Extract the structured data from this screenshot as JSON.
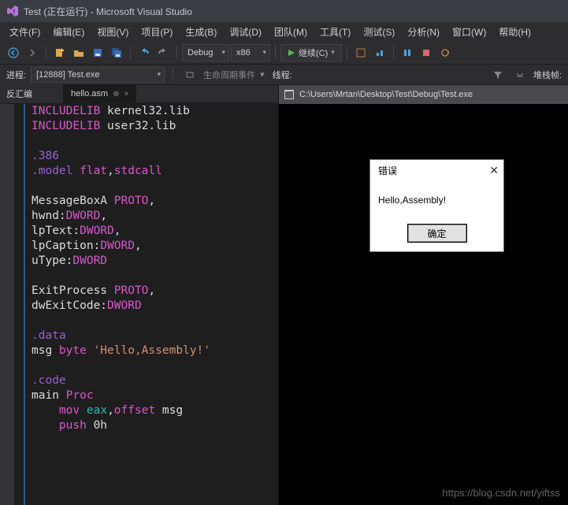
{
  "title": "Test (正在运行) - Microsoft Visual Studio",
  "menu": [
    "文件(F)",
    "编辑(E)",
    "视图(V)",
    "项目(P)",
    "生成(B)",
    "调试(D)",
    "团队(M)",
    "工具(T)",
    "测试(S)",
    "分析(N)",
    "窗口(W)",
    "帮助(H)"
  ],
  "toolbar": {
    "config": "Debug",
    "platform": "x86",
    "continue": "继续(C)"
  },
  "process": {
    "label": "进程:",
    "value": "[12888] Test.exe",
    "lifecycle": "生命周期事件",
    "thread": "线程:",
    "stackframe": "堆栈帧:"
  },
  "side_tab": "反汇编",
  "doc_tab": "hello.asm",
  "code_lines": [
    [
      {
        "c": "kw-pink",
        "t": "INCLUDELIB"
      },
      {
        "c": "txt",
        "t": " kernel32.lib"
      }
    ],
    [
      {
        "c": "kw-pink",
        "t": "INCLUDELIB"
      },
      {
        "c": "txt",
        "t": " user32.lib"
      }
    ],
    [],
    [
      {
        "c": "kw-purple",
        "t": ".386"
      }
    ],
    [
      {
        "c": "kw-purple",
        "t": ".model "
      },
      {
        "c": "kw-pink",
        "t": "flat"
      },
      {
        "c": "txt",
        "t": ","
      },
      {
        "c": "kw-pink",
        "t": "stdcall"
      }
    ],
    [],
    [
      {
        "c": "txt",
        "t": "MessageBoxA "
      },
      {
        "c": "kw-pink",
        "t": "PROTO"
      },
      {
        "c": "txt",
        "t": ","
      }
    ],
    [
      {
        "c": "txt",
        "t": "hwnd:"
      },
      {
        "c": "kw-pink",
        "t": "DWORD"
      },
      {
        "c": "txt",
        "t": ","
      }
    ],
    [
      {
        "c": "txt",
        "t": "lpText:"
      },
      {
        "c": "kw-pink",
        "t": "DWORD"
      },
      {
        "c": "txt",
        "t": ","
      }
    ],
    [
      {
        "c": "txt",
        "t": "lpCaption:"
      },
      {
        "c": "kw-pink",
        "t": "DWORD"
      },
      {
        "c": "txt",
        "t": ","
      }
    ],
    [
      {
        "c": "txt",
        "t": "uType:"
      },
      {
        "c": "kw-pink",
        "t": "DWORD"
      }
    ],
    [],
    [
      {
        "c": "txt",
        "t": "ExitProcess "
      },
      {
        "c": "kw-pink",
        "t": "PROTO"
      },
      {
        "c": "txt",
        "t": ","
      }
    ],
    [
      {
        "c": "txt",
        "t": "dwExitCode:"
      },
      {
        "c": "kw-pink",
        "t": "DWORD"
      }
    ],
    [],
    [
      {
        "c": "kw-purple",
        "t": ".data"
      }
    ],
    [
      {
        "c": "txt",
        "t": "msg "
      },
      {
        "c": "kw-pink",
        "t": "byte"
      },
      {
        "c": "txt",
        "t": " "
      },
      {
        "c": "str",
        "t": "'Hello,Assembly!'"
      }
    ],
    [],
    [
      {
        "c": "kw-purple",
        "t": ".code"
      }
    ],
    [
      {
        "c": "txt",
        "t": "main "
      },
      {
        "c": "kw-pink",
        "t": "Proc"
      }
    ],
    [
      {
        "c": "txt",
        "t": "    "
      },
      {
        "c": "kw-pink",
        "t": "mov"
      },
      {
        "c": "txt",
        "t": " "
      },
      {
        "c": "kw-teal",
        "t": "eax"
      },
      {
        "c": "txt",
        "t": ","
      },
      {
        "c": "kw-pink",
        "t": "offset"
      },
      {
        "c": "txt",
        "t": " msg"
      }
    ],
    [
      {
        "c": "txt",
        "t": "    "
      },
      {
        "c": "kw-pink",
        "t": "push"
      },
      {
        "c": "txt",
        "t": " 0h"
      }
    ]
  ],
  "console": {
    "title": "C:\\Users\\Mrtan\\Desktop\\Test\\Debug\\Test.exe"
  },
  "msgbox": {
    "title": "错误",
    "text": "Hello,Assembly!",
    "ok": "确定"
  },
  "watermark": "https://blog.csdn.net/yiftss"
}
